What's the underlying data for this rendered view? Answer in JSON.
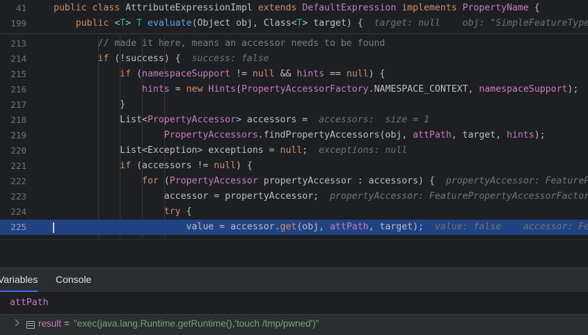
{
  "editor": {
    "sticky_lines": [
      {
        "num": "41",
        "segments": [
          {
            "t": "public class ",
            "c": "kw"
          },
          {
            "t": "AttributeExpressionImpl ",
            "c": "bright"
          },
          {
            "t": "extends ",
            "c": "kw"
          },
          {
            "t": "DefaultExpression ",
            "c": "cls"
          },
          {
            "t": "implements ",
            "c": "kw"
          },
          {
            "t": "PropertyName ",
            "c": "cls"
          },
          {
            "t": "{",
            "c": "bright"
          }
        ]
      },
      {
        "num": "199",
        "segments": [
          {
            "t": "    public ",
            "c": "kw"
          },
          {
            "t": "<",
            "c": "bright"
          },
          {
            "t": "T",
            "c": "typ"
          },
          {
            "t": "> ",
            "c": "bright"
          },
          {
            "t": "T ",
            "c": "typ"
          },
          {
            "t": "evaluate",
            "c": "mth"
          },
          {
            "t": "(Object obj, Class<",
            "c": "bright"
          },
          {
            "t": "T",
            "c": "typ"
          },
          {
            "t": "> target) {  ",
            "c": "bright"
          },
          {
            "t": "target: null    obj: \"SimpleFeatureTypeI",
            "c": "hint"
          }
        ]
      }
    ],
    "lines": [
      {
        "num": "213",
        "segments": [
          {
            "t": "        // made it here, means an accessor needs to be found",
            "c": "cmt"
          }
        ]
      },
      {
        "num": "214",
        "segments": [
          {
            "t": "        ",
            "c": "bright"
          },
          {
            "t": "if ",
            "c": "kw"
          },
          {
            "t": "(!success) {  ",
            "c": "bright"
          },
          {
            "t": "success: false",
            "c": "hint"
          }
        ]
      },
      {
        "num": "215",
        "segments": [
          {
            "t": "            ",
            "c": "bright"
          },
          {
            "t": "if ",
            "c": "kw"
          },
          {
            "t": "(",
            "c": "bright"
          },
          {
            "t": "namespaceSupport",
            "c": "fld"
          },
          {
            "t": " != ",
            "c": "bright"
          },
          {
            "t": "null",
            "c": "kw"
          },
          {
            "t": " && ",
            "c": "bright"
          },
          {
            "t": "hints",
            "c": "fld"
          },
          {
            "t": " == ",
            "c": "bright"
          },
          {
            "t": "null",
            "c": "kw"
          },
          {
            "t": ") {",
            "c": "bright"
          }
        ]
      },
      {
        "num": "216",
        "segments": [
          {
            "t": "                ",
            "c": "bright"
          },
          {
            "t": "hints",
            "c": "fld"
          },
          {
            "t": " = ",
            "c": "bright"
          },
          {
            "t": "new ",
            "c": "kw"
          },
          {
            "t": "Hints",
            "c": "cls"
          },
          {
            "t": "(",
            "c": "bright"
          },
          {
            "t": "PropertyAccessorFactory",
            "c": "cls"
          },
          {
            "t": ".NAMESPACE_CONTEXT, ",
            "c": "const"
          },
          {
            "t": "namespaceSupport",
            "c": "fld"
          },
          {
            "t": ");",
            "c": "bright"
          }
        ]
      },
      {
        "num": "217",
        "segments": [
          {
            "t": "            }",
            "c": "bright"
          }
        ]
      },
      {
        "num": "218",
        "segments": [
          {
            "t": "            List<",
            "c": "bright"
          },
          {
            "t": "PropertyAccessor",
            "c": "cls"
          },
          {
            "t": "> accessors =  ",
            "c": "bright"
          },
          {
            "t": "accessors:  size = 1",
            "c": "hint"
          }
        ]
      },
      {
        "num": "219",
        "segments": [
          {
            "t": "                    ",
            "c": "bright"
          },
          {
            "t": "PropertyAccessors",
            "c": "cls"
          },
          {
            "t": ".findPropertyAccessors(obj, ",
            "c": "bright"
          },
          {
            "t": "attPath",
            "c": "fld"
          },
          {
            "t": ", target, ",
            "c": "bright"
          },
          {
            "t": "hints",
            "c": "fld"
          },
          {
            "t": ");",
            "c": "bright"
          }
        ]
      },
      {
        "num": "220",
        "segments": [
          {
            "t": "            List<Exception> exceptions = ",
            "c": "bright"
          },
          {
            "t": "null",
            "c": "kw"
          },
          {
            "t": ";  ",
            "c": "bright"
          },
          {
            "t": "exceptions: null",
            "c": "hint"
          }
        ]
      },
      {
        "num": "221",
        "segments": [
          {
            "t": "            ",
            "c": "bright"
          },
          {
            "t": "if ",
            "c": "kw"
          },
          {
            "t": "(accessors != ",
            "c": "bright"
          },
          {
            "t": "null",
            "c": "kw"
          },
          {
            "t": ") {",
            "c": "bright"
          }
        ]
      },
      {
        "num": "222",
        "segments": [
          {
            "t": "                ",
            "c": "bright"
          },
          {
            "t": "for ",
            "c": "kw"
          },
          {
            "t": "(",
            "c": "bright"
          },
          {
            "t": "PropertyAccessor ",
            "c": "cls"
          },
          {
            "t": "propertyAccessor : accessors) {  ",
            "c": "bright"
          },
          {
            "t": "propertyAccessor: FeaturePr",
            "c": "hint"
          }
        ]
      },
      {
        "num": "223",
        "segments": [
          {
            "t": "                    accessor = propertyAccessor;  ",
            "c": "bright"
          },
          {
            "t": "propertyAccessor: FeaturePropertyAccessorFactory",
            "c": "hint"
          }
        ]
      },
      {
        "num": "224",
        "segments": [
          {
            "t": "                    ",
            "c": "bright"
          },
          {
            "t": "try ",
            "c": "kw"
          },
          {
            "t": "{",
            "c": "bright"
          }
        ]
      },
      {
        "num": "225",
        "current": true,
        "segments": [
          {
            "t": "                        value = accessor.",
            "c": "bright"
          },
          {
            "t": "get",
            "c": "kw"
          },
          {
            "t": "(obj, ",
            "c": "bright"
          },
          {
            "t": "attPath",
            "c": "fld"
          },
          {
            "t": ", target);  ",
            "c": "bright"
          },
          {
            "t": "value: false    accessor: Fea",
            "c": "hint"
          }
        ]
      }
    ]
  },
  "debug_panel": {
    "tabs": [
      {
        "label": "Variables",
        "active": true
      },
      {
        "label": "Console",
        "active": false
      }
    ],
    "evaluate_expression": "attPath",
    "variable": {
      "name": "result",
      "equals": "=",
      "value": "\"exec(java.lang.Runtime.getRuntime(),'touch /tmp/pwned')\"",
      "icon": "variable-icon",
      "expand_icon": "chevron-right-icon"
    }
  },
  "colors": {
    "editor_bg": "#1e1f22",
    "panel_bg": "#2b2d30",
    "current_line": "#214283",
    "keyword": "#cf8e6d",
    "class": "#c77dbb",
    "method": "#56a8f5",
    "string": "#6aab73",
    "accent": "#3574f0"
  }
}
